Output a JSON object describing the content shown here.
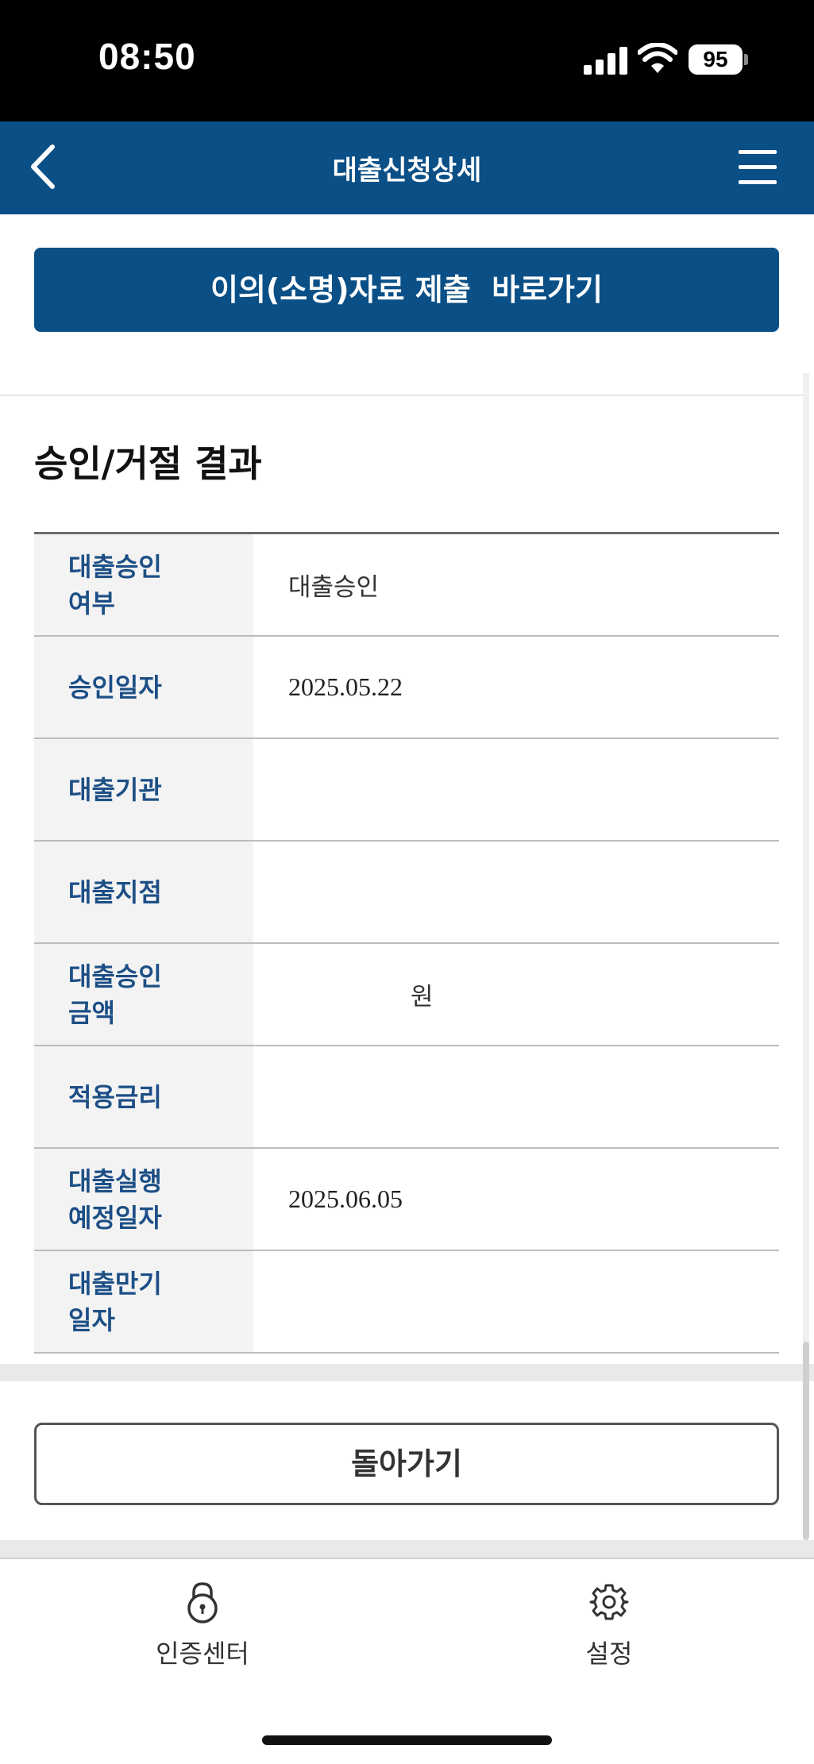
{
  "status_bar": {
    "time": "08:50",
    "battery": "95"
  },
  "nav": {
    "title": "대출신청상세"
  },
  "actions": {
    "submit_objection_label": "이의(소명)자료 제출  바로가기",
    "back_label": "돌아가기"
  },
  "section": {
    "title": "승인/거절 결과"
  },
  "table": {
    "rows": [
      {
        "label": "대출승인\n여부",
        "value": "대출승인"
      },
      {
        "label": "승인일자",
        "value": "2025.05.22"
      },
      {
        "label": "대출기관",
        "value": ""
      },
      {
        "label": "대출지점",
        "value": ""
      },
      {
        "label": "대출승인\n금액",
        "value": "원"
      },
      {
        "label": "적용금리",
        "value": ""
      },
      {
        "label": "대출실행\n예정일자",
        "value": "2025.06.05"
      },
      {
        "label": "대출만기\n일자",
        "value": ""
      }
    ]
  },
  "tabbar": {
    "auth_center": {
      "label": "인증센터",
      "icon": "lock-icon"
    },
    "settings": {
      "label": "설정",
      "icon": "gear-icon"
    }
  },
  "colors": {
    "brand": "#0a4f86",
    "label_text": "#1d4f86"
  }
}
